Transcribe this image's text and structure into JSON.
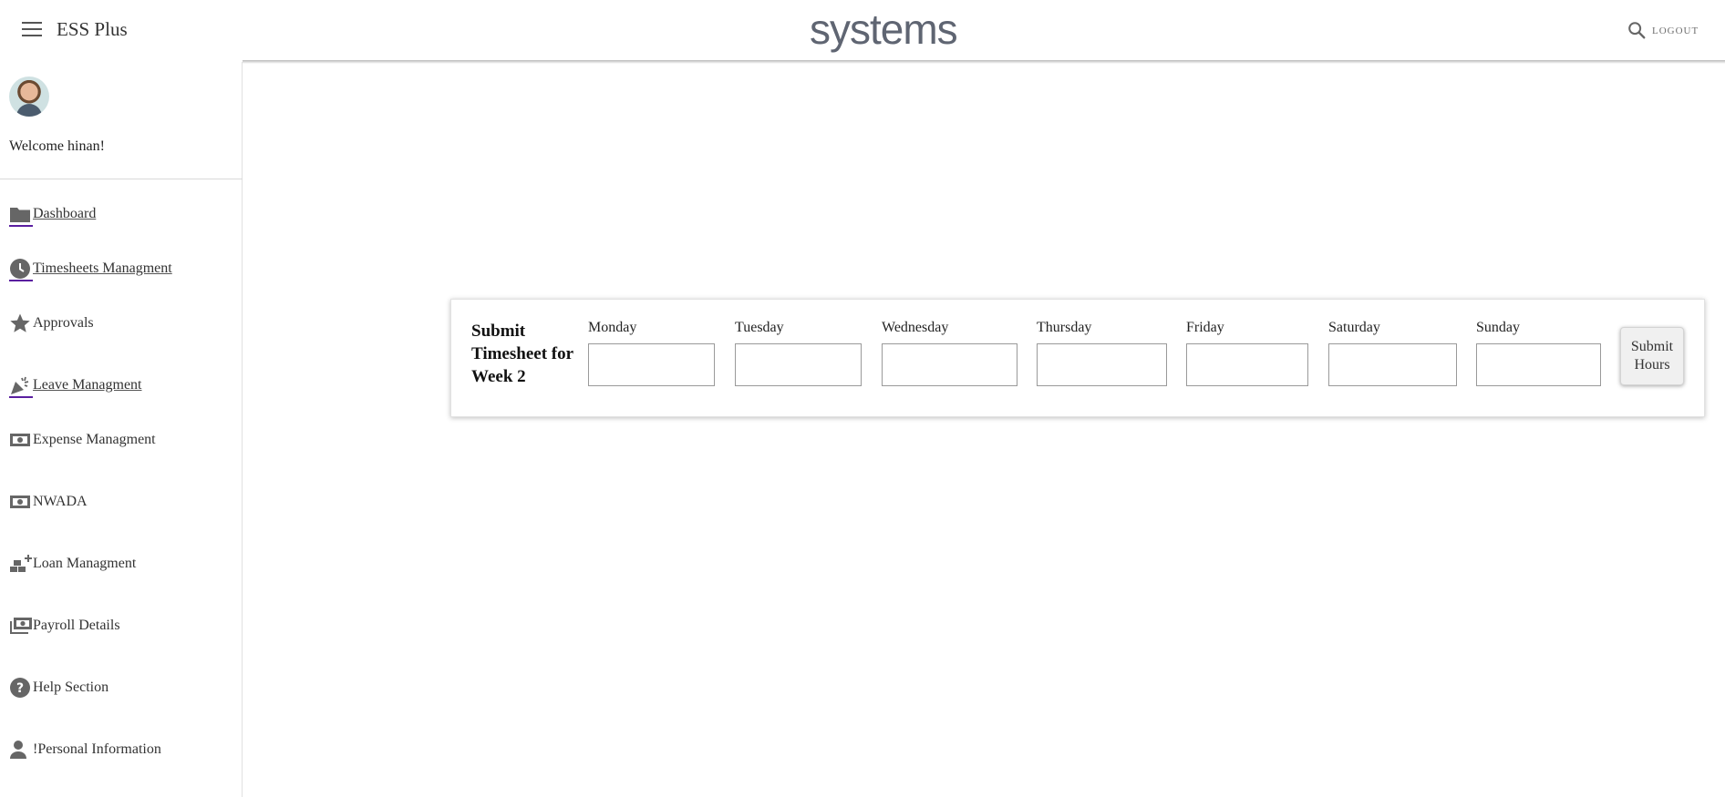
{
  "header": {
    "app_title": "ESS Plus",
    "brand": "systems",
    "logout_label": "LOGOUT"
  },
  "sidebar": {
    "welcome": "Welcome hinan!",
    "items": [
      {
        "label": "Dashboard",
        "icon": "folder-icon"
      },
      {
        "label": "Timesheets Managment",
        "icon": "clock-icon"
      },
      {
        "label": "Approvals",
        "icon": "star-icon"
      },
      {
        "label": "Leave Managment",
        "icon": "celebration-icon"
      },
      {
        "label": "Expense Managment",
        "icon": "money-icon"
      },
      {
        "label": "NWADA",
        "icon": "money-icon"
      },
      {
        "label": "Loan Managment",
        "icon": "loan-icon"
      },
      {
        "label": "Payroll Details",
        "icon": "payments-icon"
      },
      {
        "label": "Help Section",
        "icon": "help-icon"
      },
      {
        "label": "!Personal Information",
        "icon": "person-icon"
      }
    ]
  },
  "timesheet": {
    "title": "Submit Timesheet for Week 2",
    "days": [
      "Monday",
      "Tuesday",
      "Wednesday",
      "Thursday",
      "Friday",
      "Saturday",
      "Sunday"
    ],
    "values": [
      "",
      "",
      "",
      "",
      "",
      "",
      ""
    ],
    "submit_label": "Submit Hours"
  },
  "colors": {
    "accent_underline": "#5a1fa0",
    "icon_gray": "#666666",
    "brand_gray": "#5f6572"
  }
}
